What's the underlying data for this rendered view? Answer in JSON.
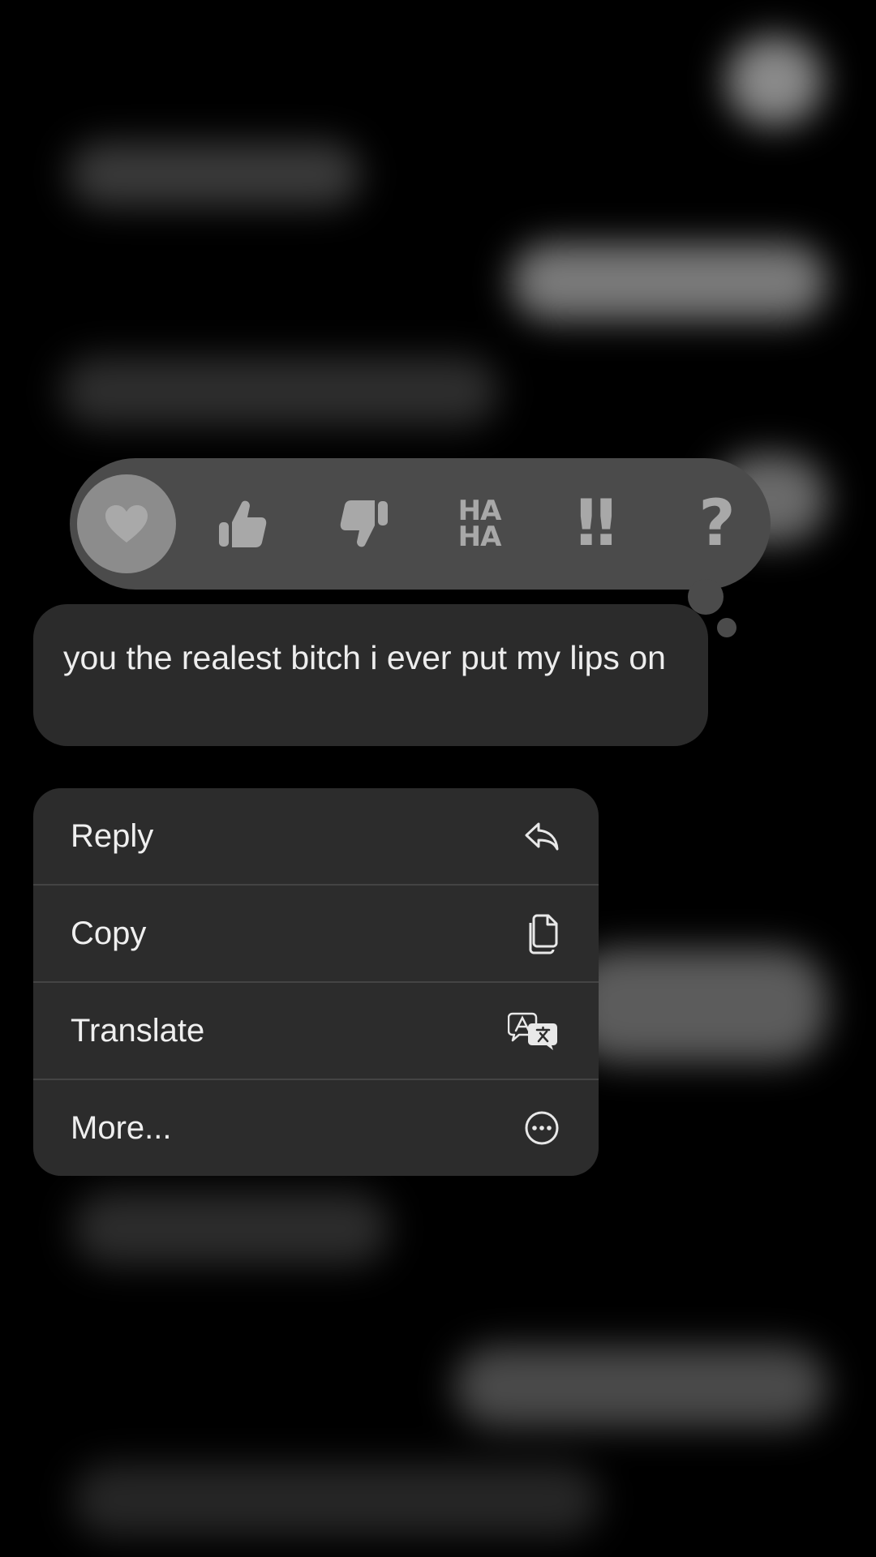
{
  "colors": {
    "background": "#000000",
    "tapback_bar": "#4b4b4b",
    "selected_reaction": "#8c8c8c",
    "reaction_icon": "#a8a8a8",
    "message_bubble": "#2b2b2b",
    "menu_background": "#2c2c2c",
    "text": "#ededed"
  },
  "tapback": {
    "selected": "heart",
    "reactions": [
      {
        "id": "heart",
        "icon": "heart-icon"
      },
      {
        "id": "like",
        "icon": "thumbs-up-icon"
      },
      {
        "id": "dislike",
        "icon": "thumbs-down-icon"
      },
      {
        "id": "haha",
        "icon": "haha-icon",
        "line1": "HA",
        "line2": "HA"
      },
      {
        "id": "emphasize",
        "icon": "double-exclamation-icon",
        "glyph": "‼"
      },
      {
        "id": "question",
        "icon": "question-mark-icon",
        "glyph": "?"
      }
    ]
  },
  "message": {
    "text": "you the realest bitch i ever put my lips on"
  },
  "context_menu": {
    "items": [
      {
        "label": "Reply",
        "icon": "reply-arrow-icon"
      },
      {
        "label": "Copy",
        "icon": "copy-documents-icon"
      },
      {
        "label": "Translate",
        "icon": "translate-icon"
      },
      {
        "label": "More...",
        "icon": "more-ellipsis-icon"
      }
    ]
  }
}
